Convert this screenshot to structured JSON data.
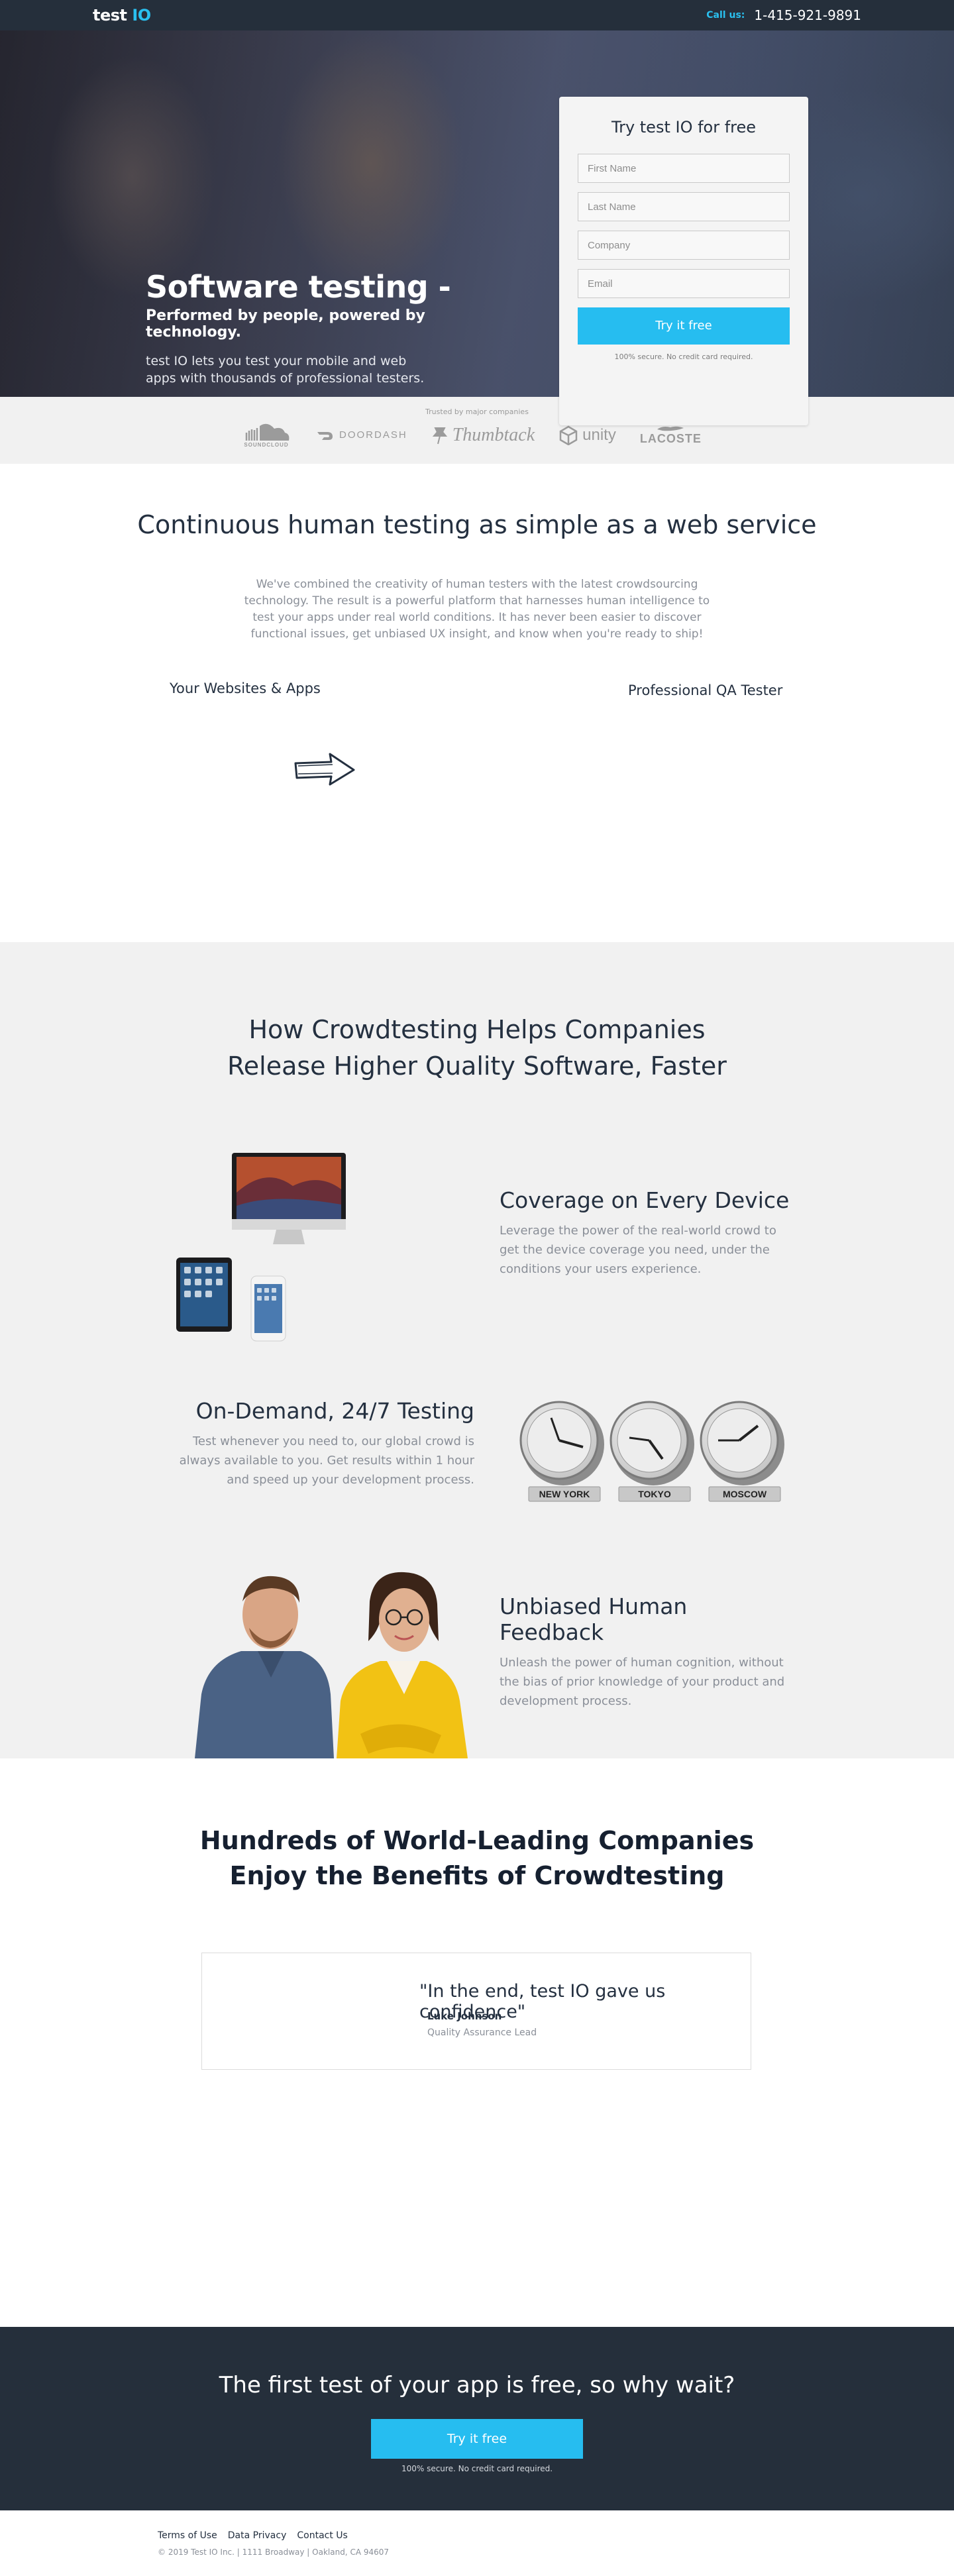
{
  "header": {
    "logo_text": "test ",
    "logo_accent": "IO",
    "call_label": "Call us:",
    "phone": "1-415-921-9891"
  },
  "hero": {
    "title": "Software testing -",
    "subtitle": "Performed by people, powered by technology.",
    "description": "test IO lets you test your mobile and web apps with thousands of professional testers."
  },
  "signup": {
    "title": "Try test IO for free",
    "first_name_placeholder": "First Name",
    "last_name_placeholder": "Last Name",
    "company_placeholder": "Company",
    "email_placeholder": "Email",
    "button_label": "Try it free",
    "note": "100% secure. No credit card required."
  },
  "trusted": {
    "caption": "Trusted by major companies",
    "brands": [
      "SOUNDCLOUD",
      "DOORDASH",
      "Thumbtack",
      "unity",
      "LACOSTE"
    ]
  },
  "continuous": {
    "title": "Continuous human testing as simple as a web service",
    "description": "We've combined the creativity of human testers with the latest crowdsourcing technology. The result is a powerful platform that harnesses human intelligence to test your apps under real world conditions. It has never been easier to discover functional issues, get unbiased UX insight, and know when you're ready to ship!",
    "left_label": "Your Websites & Apps",
    "right_label": "Professional QA Tester"
  },
  "crowd": {
    "title_line1": "How Crowdtesting Helps Companies",
    "title_line2": "Release Higher Quality Software, Faster",
    "features": [
      {
        "title": "Coverage on Every Device",
        "text": "Leverage the power of the real-world crowd to get the device coverage you need, under the conditions your users experience."
      },
      {
        "title": "On-Demand, 24/7 Testing",
        "text": "Test whenever you need to, our global crowd is always available to you. Get results within 1 hour and speed up your development process."
      },
      {
        "title": "Unbiased Human Feedback",
        "text": "Unleash the power of human cognition, without the bias of prior knowledge of your product and development process."
      }
    ],
    "clocks": [
      "NEW YORK",
      "TOKYO",
      "MOSCOW"
    ]
  },
  "companies": {
    "title_line1": "Hundreds of World-Leading Companies",
    "title_line2": "Enjoy the Benefits of Crowdtesting",
    "testimonial": {
      "quote": "\"In the end, test IO gave us confidence\"",
      "name": "Luke Johnson",
      "role": "Quality Assurance Lead"
    }
  },
  "cta": {
    "title": "The first test of your app is free, so why wait?",
    "button_label": "Try it free",
    "note": "100% secure. No credit card required."
  },
  "footer": {
    "links": [
      "Terms of Use",
      "Data Privacy",
      "Contact Us"
    ],
    "copyright": "© 2019 Test IO Inc. | 1111 Broadway | Oakland, CA 94607"
  },
  "colors": {
    "accent": "#26bdf0",
    "dark": "#252f3b",
    "light_bg": "#f1f1f1"
  }
}
